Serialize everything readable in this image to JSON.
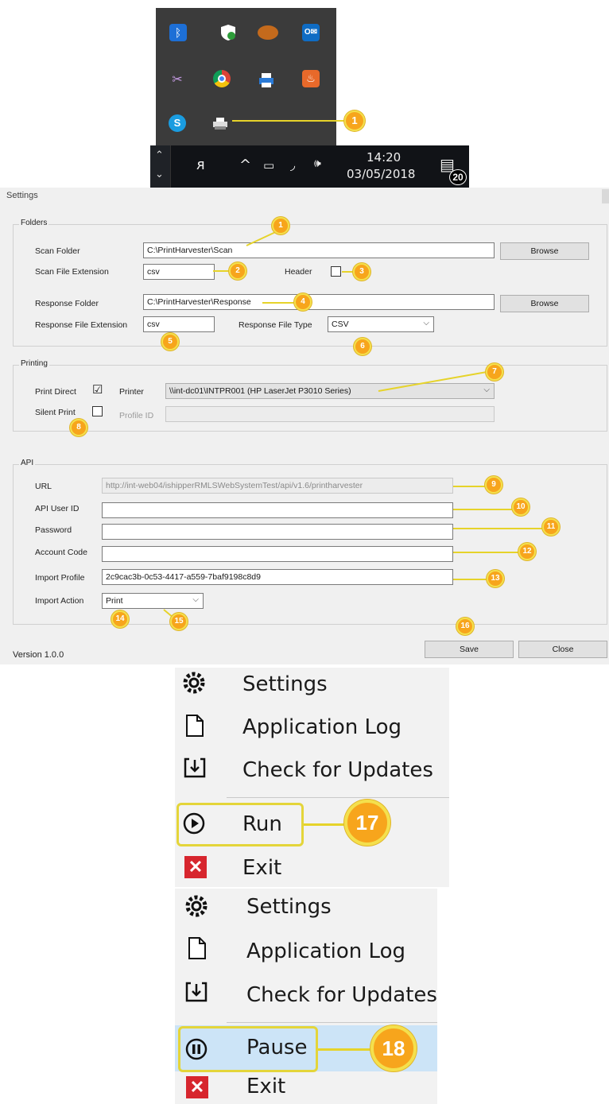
{
  "tray": {
    "icons": [
      "bluetooth-icon",
      "windows-security-icon",
      "orange-app-icon",
      "outlook-icon",
      "onenote-clip-icon",
      "chrome-icon",
      "printer-icon",
      "java-icon",
      "skype-icon",
      "printharvester-icon"
    ],
    "time": "14:20",
    "date": "03/05/2018",
    "notification_count": "20"
  },
  "settings": {
    "window_title": "Settings",
    "folders": {
      "group_label": "Folders",
      "scan_folder_label": "Scan Folder",
      "scan_folder_value": "C:\\PrintHarvester\\Scan",
      "browse_label": "Browse",
      "scan_ext_label": "Scan File Extension",
      "scan_ext_value": "csv",
      "header_label": "Header",
      "response_folder_label": "Response Folder",
      "response_folder_value": "C:\\PrintHarvester\\Response",
      "response_ext_label": "Response File Extension",
      "response_ext_value": "csv",
      "response_type_label": "Response File Type",
      "response_type_value": "CSV"
    },
    "printing": {
      "group_label": "Printing",
      "print_direct_label": "Print Direct",
      "print_direct_checked": "☑",
      "printer_label": "Printer",
      "printer_value": "\\\\int-dc01\\INTPR001 (HP LaserJet P3010 Series)",
      "silent_print_label": "Silent Print",
      "profile_id_label": "Profile ID"
    },
    "api": {
      "group_label": "API",
      "url_label": "URL",
      "url_value": "http://int-web04/ishipperRMLSWebSystemTest/api/v1.6/printharvester",
      "user_id_label": "API User ID",
      "password_label": "Password",
      "account_code_label": "Account Code",
      "import_profile_label": "Import Profile",
      "import_profile_value": "2c9cac3b-0c53-4417-a559-7baf9198c8d9",
      "import_action_label": "Import Action",
      "import_action_value": "Print"
    },
    "version": "Version 1.0.0",
    "save_label": "Save",
    "close_label": "Close"
  },
  "callouts": [
    "1",
    "1",
    "2",
    "3",
    "4",
    "5",
    "6",
    "7",
    "8",
    "9",
    "10",
    "11",
    "12",
    "13",
    "14",
    "15",
    "16",
    "17",
    "18"
  ],
  "menu_run": {
    "items": [
      "Settings",
      "Application Log",
      "Check for Updates",
      "Run",
      "Exit"
    ]
  },
  "menu_pause": {
    "items": [
      "Settings",
      "Application Log",
      "Check for Updates",
      "Pause",
      "Exit"
    ]
  },
  "colors": {
    "callout": "#f7a51c",
    "leader": "#e6d32a",
    "highlight_row": "#cce4f7"
  }
}
